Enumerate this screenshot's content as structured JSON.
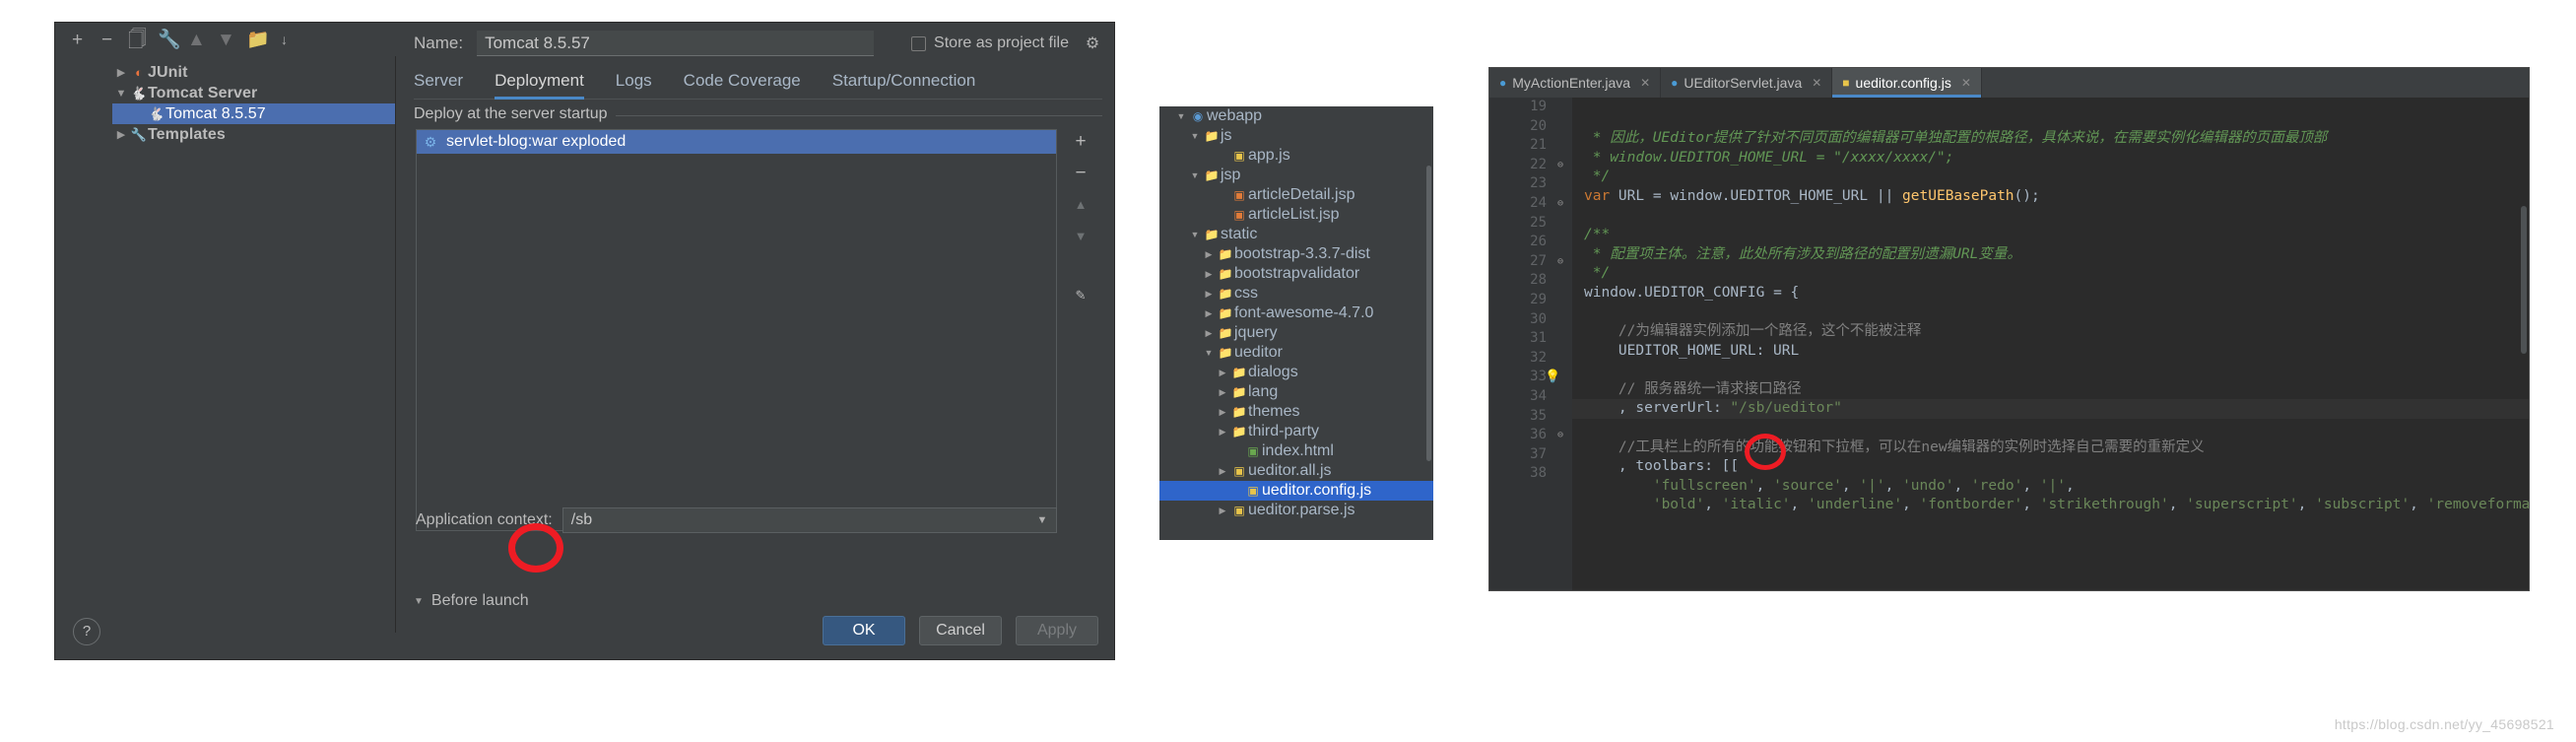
{
  "dialog": {
    "toolbar_icons": [
      "add-icon",
      "remove-icon",
      "copy-icon",
      "edit-templates-icon",
      "move-up-icon",
      "move-down-icon",
      "folder-icon",
      "sort-icon"
    ],
    "tree": [
      {
        "label": "JUnit",
        "expanded": false,
        "icon": "junit-icon",
        "indent": 0,
        "selected": false,
        "bold": true
      },
      {
        "label": "Tomcat Server",
        "expanded": true,
        "icon": "tomcat-icon",
        "indent": 0,
        "selected": false,
        "bold": true
      },
      {
        "label": "Tomcat 8.5.57",
        "expanded": null,
        "icon": "tomcat-icon",
        "indent": 1,
        "selected": true,
        "bold": false
      },
      {
        "label": "Templates",
        "expanded": false,
        "icon": "wrench-icon",
        "indent": 0,
        "selected": false,
        "bold": true
      }
    ],
    "name_label": "Name:",
    "name_value": "Tomcat 8.5.57",
    "store_as_project_file_label": "Store as project file",
    "store_as_project_file_checked": false,
    "tabs": [
      {
        "label": "Server",
        "active": false
      },
      {
        "label": "Deployment",
        "active": true
      },
      {
        "label": "Logs",
        "active": false
      },
      {
        "label": "Code Coverage",
        "active": false
      },
      {
        "label": "Startup/Connection",
        "active": false
      }
    ],
    "deploy_group_title": "Deploy at the server startup",
    "deploy_items": [
      {
        "label": "servlet-blog:war exploded",
        "icon": "artifact-icon",
        "selected": true
      }
    ],
    "side_buttons": [
      "add-icon",
      "remove-icon",
      "move-up-icon",
      "move-down-icon",
      "edit-icon"
    ],
    "appctx_label": "Application context:",
    "appctx_value": "/sb",
    "before_launch_label": "Before launch",
    "buttons": {
      "ok": "OK",
      "cancel": "Cancel",
      "apply": "Apply",
      "help": "?"
    },
    "annotation": {
      "type": "red-circle",
      "target": "application-context-value"
    }
  },
  "project_tree": {
    "rows": [
      {
        "label": "webapp",
        "indent": 1,
        "twisty": "down",
        "icon": "webapp-folder-icon",
        "selected": false
      },
      {
        "label": "js",
        "indent": 2,
        "twisty": "down",
        "icon": "folder-icon",
        "selected": false
      },
      {
        "label": "app.js",
        "indent": 4,
        "twisty": "none",
        "icon": "js-file-icon",
        "selected": false
      },
      {
        "label": "jsp",
        "indent": 2,
        "twisty": "down",
        "icon": "folder-icon",
        "selected": false
      },
      {
        "label": "articleDetail.jsp",
        "indent": 4,
        "twisty": "none",
        "icon": "jsp-file-icon",
        "selected": false
      },
      {
        "label": "articleList.jsp",
        "indent": 4,
        "twisty": "none",
        "icon": "jsp-file-icon",
        "selected": false
      },
      {
        "label": "static",
        "indent": 2,
        "twisty": "down",
        "icon": "folder-icon",
        "selected": false
      },
      {
        "label": "bootstrap-3.3.7-dist",
        "indent": 3,
        "twisty": "right",
        "icon": "folder-icon",
        "selected": false
      },
      {
        "label": "bootstrapvalidator",
        "indent": 3,
        "twisty": "right",
        "icon": "folder-icon",
        "selected": false
      },
      {
        "label": "css",
        "indent": 3,
        "twisty": "right",
        "icon": "folder-icon",
        "selected": false
      },
      {
        "label": "font-awesome-4.7.0",
        "indent": 3,
        "twisty": "right",
        "icon": "folder-icon",
        "selected": false
      },
      {
        "label": "jquery",
        "indent": 3,
        "twisty": "right",
        "icon": "folder-icon",
        "selected": false
      },
      {
        "label": "ueditor",
        "indent": 3,
        "twisty": "down",
        "icon": "folder-icon",
        "selected": false
      },
      {
        "label": "dialogs",
        "indent": 4,
        "twisty": "right",
        "icon": "folder-icon",
        "selected": false
      },
      {
        "label": "lang",
        "indent": 4,
        "twisty": "right",
        "icon": "folder-icon",
        "selected": false
      },
      {
        "label": "themes",
        "indent": 4,
        "twisty": "right",
        "icon": "folder-icon",
        "selected": false
      },
      {
        "label": "third-party",
        "indent": 4,
        "twisty": "right",
        "icon": "folder-icon",
        "selected": false
      },
      {
        "label": "index.html",
        "indent": 5,
        "twisty": "none",
        "icon": "html-file-icon",
        "selected": false
      },
      {
        "label": "ueditor.all.js",
        "indent": 4,
        "twisty": "right",
        "icon": "js-file-icon",
        "selected": false
      },
      {
        "label": "ueditor.config.js",
        "indent": 5,
        "twisty": "none",
        "icon": "js-file-icon",
        "selected": true
      },
      {
        "label": "ueditor.parse.js",
        "indent": 4,
        "twisty": "right",
        "icon": "js-file-icon",
        "selected": false
      }
    ]
  },
  "editor": {
    "tabs": [
      {
        "label": "MyActionEnter.java",
        "icon": "java-class-icon",
        "active": false
      },
      {
        "label": "UEditorServlet.java",
        "icon": "java-class-icon",
        "active": false
      },
      {
        "label": "ueditor.config.js",
        "icon": "js-file-icon",
        "active": true
      }
    ],
    "first_line_number": 19,
    "lines": [
      {
        "n": 19,
        "fold": "",
        "bulb": false,
        "hl": false,
        "segments": [
          {
            "t": " * 因此，UEditor提供了针对不同页面的编辑器可单独配置的根路径，具体来说，在需要实例化编辑器的页面最顶部",
            "c": "cmt"
          }
        ]
      },
      {
        "n": 20,
        "fold": "",
        "bulb": false,
        "hl": false,
        "segments": [
          {
            "t": " * window.UEDITOR_HOME_URL = \"/xxxx/xxxx/\";",
            "c": "cmt"
          }
        ]
      },
      {
        "n": 21,
        "fold": "",
        "bulb": false,
        "hl": false,
        "segments": [
          {
            "t": " */",
            "c": "cmt"
          }
        ]
      },
      {
        "n": 22,
        "fold": "fold",
        "bulb": false,
        "hl": false,
        "segments": [
          {
            "t": "var ",
            "c": "kw"
          },
          {
            "t": "URL = ",
            "c": "op"
          },
          {
            "t": "window",
            "c": "op"
          },
          {
            "t": ".UEDITOR_HOME_URL ",
            "c": "op"
          },
          {
            "t": "|| ",
            "c": "op"
          },
          {
            "t": "getUEBasePath",
            "c": "fn"
          },
          {
            "t": "();",
            "c": "op"
          }
        ]
      },
      {
        "n": 23,
        "fold": "",
        "bulb": false,
        "hl": false,
        "segments": [
          {
            "t": "",
            "c": "op"
          }
        ]
      },
      {
        "n": 24,
        "fold": "fold",
        "bulb": false,
        "hl": false,
        "segments": [
          {
            "t": "/**",
            "c": "cmt"
          }
        ]
      },
      {
        "n": 25,
        "fold": "",
        "bulb": false,
        "hl": false,
        "segments": [
          {
            "t": " * 配置项主体。注意，此处所有涉及到路径的配置别遗漏URL变量。",
            "c": "cmt"
          }
        ]
      },
      {
        "n": 26,
        "fold": "",
        "bulb": false,
        "hl": false,
        "segments": [
          {
            "t": " */",
            "c": "cmt"
          }
        ]
      },
      {
        "n": 27,
        "fold": "fold",
        "bulb": false,
        "hl": false,
        "segments": [
          {
            "t": "window",
            "c": "op"
          },
          {
            "t": ".UEDITOR_CONFIG = {",
            "c": "op"
          }
        ]
      },
      {
        "n": 28,
        "fold": "",
        "bulb": false,
        "hl": false,
        "segments": [
          {
            "t": "",
            "c": "op"
          }
        ]
      },
      {
        "n": 29,
        "fold": "",
        "bulb": false,
        "hl": false,
        "segments": [
          {
            "t": "    //为编辑器实例添加一个路径，这个不能被注释",
            "c": "cmt-b"
          }
        ]
      },
      {
        "n": 30,
        "fold": "",
        "bulb": false,
        "hl": false,
        "segments": [
          {
            "t": "    UEDITOR_HOME_URL: URL",
            "c": "op"
          }
        ]
      },
      {
        "n": 31,
        "fold": "",
        "bulb": false,
        "hl": false,
        "segments": [
          {
            "t": "",
            "c": "op"
          }
        ]
      },
      {
        "n": 32,
        "fold": "",
        "bulb": false,
        "hl": false,
        "segments": [
          {
            "t": "    // 服务器统一请求接口路径",
            "c": "cmt-b"
          }
        ]
      },
      {
        "n": 33,
        "fold": "",
        "bulb": true,
        "hl": true,
        "segments": [
          {
            "t": "    , serverUrl: ",
            "c": "op"
          },
          {
            "t": "\"/sb/ueditor\"",
            "c": "str"
          }
        ]
      },
      {
        "n": 34,
        "fold": "",
        "bulb": false,
        "hl": false,
        "segments": [
          {
            "t": "",
            "c": "op"
          }
        ]
      },
      {
        "n": 35,
        "fold": "",
        "bulb": false,
        "hl": false,
        "segments": [
          {
            "t": "    //工具栏上的所有的功能按钮和下拉框，可以在new编辑器的实例时选择自己需要的重新定义",
            "c": "cmt-b"
          }
        ]
      },
      {
        "n": 36,
        "fold": "fold",
        "bulb": false,
        "hl": false,
        "segments": [
          {
            "t": "    , toolbars: [[",
            "c": "op"
          }
        ]
      },
      {
        "n": 37,
        "fold": "",
        "bulb": false,
        "hl": false,
        "segments": [
          {
            "t": "        ",
            "c": "op"
          },
          {
            "t": "'fullscreen'",
            "c": "str"
          },
          {
            "t": ", ",
            "c": "op"
          },
          {
            "t": "'source'",
            "c": "str"
          },
          {
            "t": ", ",
            "c": "op"
          },
          {
            "t": "'|'",
            "c": "str"
          },
          {
            "t": ", ",
            "c": "op"
          },
          {
            "t": "'undo'",
            "c": "str"
          },
          {
            "t": ", ",
            "c": "op"
          },
          {
            "t": "'redo'",
            "c": "str"
          },
          {
            "t": ", ",
            "c": "op"
          },
          {
            "t": "'|'",
            "c": "str"
          },
          {
            "t": ",",
            "c": "op"
          }
        ]
      },
      {
        "n": 38,
        "fold": "",
        "bulb": false,
        "hl": false,
        "segments": [
          {
            "t": "        ",
            "c": "op"
          },
          {
            "t": "'bold'",
            "c": "str"
          },
          {
            "t": ", ",
            "c": "op"
          },
          {
            "t": "'italic'",
            "c": "str"
          },
          {
            "t": ", ",
            "c": "op"
          },
          {
            "t": "'underline'",
            "c": "str"
          },
          {
            "t": ", ",
            "c": "op"
          },
          {
            "t": "'fontborder'",
            "c": "str"
          },
          {
            "t": ", ",
            "c": "op"
          },
          {
            "t": "'strikethrough'",
            "c": "str"
          },
          {
            "t": ", ",
            "c": "op"
          },
          {
            "t": "'superscript'",
            "c": "str"
          },
          {
            "t": ", ",
            "c": "op"
          },
          {
            "t": "'subscript'",
            "c": "str"
          },
          {
            "t": ", ",
            "c": "op"
          },
          {
            "t": "'removeformat'",
            "c": "str"
          }
        ]
      }
    ],
    "annotation": {
      "type": "red-circle",
      "target": "server-url-sb-path"
    }
  },
  "watermark": "https://blog.csdn.net/yy_45698521",
  "colors": {
    "accent_blue": "#4a88c7",
    "selection_blue": "#4b6eaf",
    "tree_selection": "#2f65ca",
    "annotation_red": "#ee1c24",
    "dialog_bg": "#3c3f41",
    "editor_bg": "#2b2b2b",
    "ok_button": "#365880"
  }
}
